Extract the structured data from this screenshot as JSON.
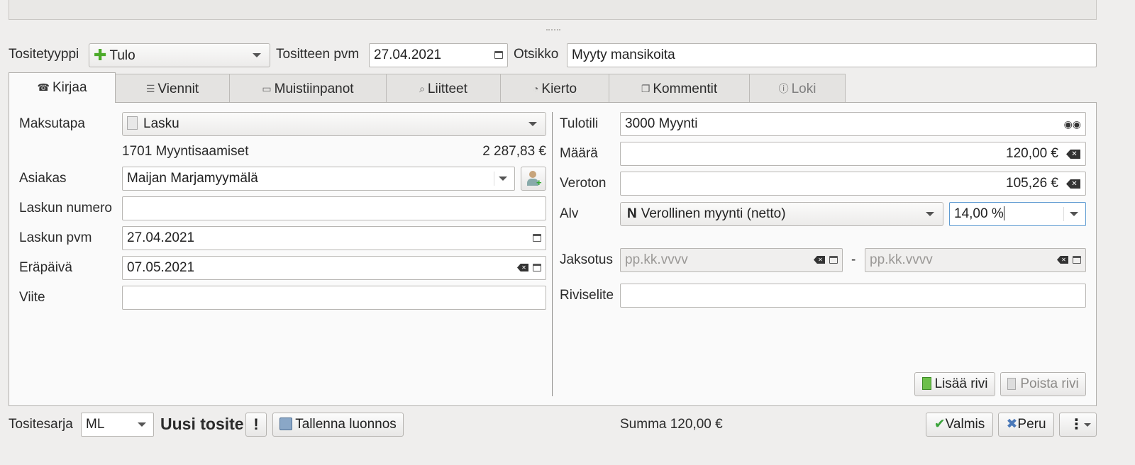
{
  "header": {
    "type_label": "Tositetyyppi",
    "type_value": "Tulo",
    "date_label": "Tositteen pvm",
    "date_value": "27.04.2021",
    "title_label": "Otsikko",
    "title_value": "Myyty mansikoita"
  },
  "tabs": [
    {
      "label": "Kirjaa",
      "icon": "phone-icon"
    },
    {
      "label": "Viennit",
      "icon": "list-icon"
    },
    {
      "label": "Muistiinpanot",
      "icon": "note-icon"
    },
    {
      "label": "Liitteet",
      "icon": "paperclip-icon"
    },
    {
      "label": "Kierto",
      "icon": "cycle-icon"
    },
    {
      "label": "Kommentit",
      "icon": "comment-icon"
    },
    {
      "label": "Loki",
      "icon": "info-icon"
    }
  ],
  "left": {
    "payment_label": "Maksutapa",
    "payment_value": "Lasku",
    "account_name": "1701 Myyntisaamiset",
    "account_amount": "2 287,83 €",
    "customer_label": "Asiakas",
    "customer_value": "Maijan Marjamyymälä",
    "invoice_number_label": "Laskun numero",
    "invoice_number_value": "",
    "invoice_date_label": "Laskun pvm",
    "invoice_date_value": "27.04.2021",
    "due_date_label": "Eräpäivä",
    "due_date_value": "07.05.2021",
    "reference_label": "Viite",
    "reference_value": ""
  },
  "right": {
    "income_account_label": "Tulotili",
    "income_account_value": "3000 Myynti",
    "amount_label": "Määrä",
    "amount_value": "120,00 €",
    "net_label": "Veroton",
    "net_value": "105,26 €",
    "vat_label": "Alv",
    "vat_code": "N",
    "vat_type": "Verollinen myynti (netto)",
    "vat_rate": "14,00 %",
    "period_label": "Jaksotus",
    "period_start_placeholder": "pp.kk.vvvv",
    "period_dash": "-",
    "period_end_placeholder": "pp.kk.vvvv",
    "row_desc_label": "Riviselite",
    "row_desc_value": "",
    "add_row": "Lisää rivi",
    "remove_row": "Poista rivi"
  },
  "footer": {
    "series_label": "Tositesarja",
    "series_value": "ML",
    "new_doc": "Uusi tosite",
    "save_draft": "Tallenna luonnos",
    "sum": "Summa 120,00 €",
    "ready": "Valmis",
    "cancel": "Peru"
  }
}
